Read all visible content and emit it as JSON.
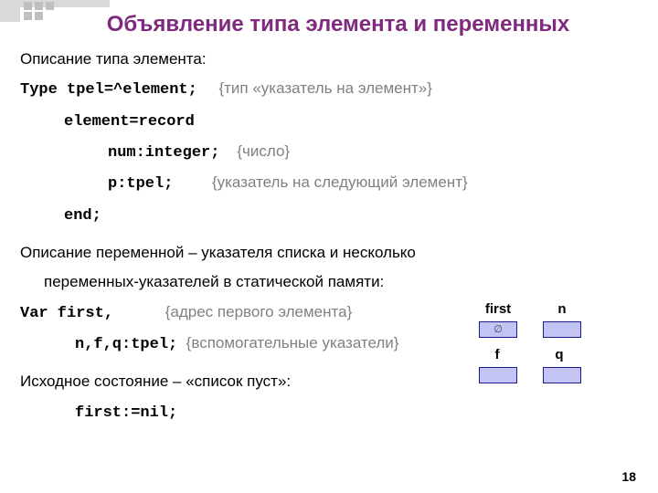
{
  "title": "Объявление типа элемента и переменных",
  "section1": {
    "intro": "Описание типа элемента:",
    "line1_code": "Type tpel=^element;",
    "line1_cm": "{тип «указатель на элемент»}",
    "line2_code": "element=record",
    "line3_code": "num:integer;",
    "line3_cm": "{число}",
    "line4_code": "p:tpel;",
    "line4_cm": "{указатель на следующий элемент}",
    "line5_code": "end;"
  },
  "section2": {
    "intro_a": "Описание переменной – указателя  списка  и несколько",
    "intro_b": "переменных-указателей в статической памяти:",
    "line1_code": "Var first,",
    "line1_cm": "{адрес первого элемента}",
    "line2_code": "n,f,q:tpel;",
    "line2_cm": "{вспомогательные указатели}"
  },
  "section3": {
    "intro": "Исходное состояние – «список пуст»:",
    "line1_code": "first:=nil;"
  },
  "diagram": {
    "first": "first",
    "n": "n",
    "f": "f",
    "q": "q",
    "nil": "∅"
  },
  "page": "18"
}
